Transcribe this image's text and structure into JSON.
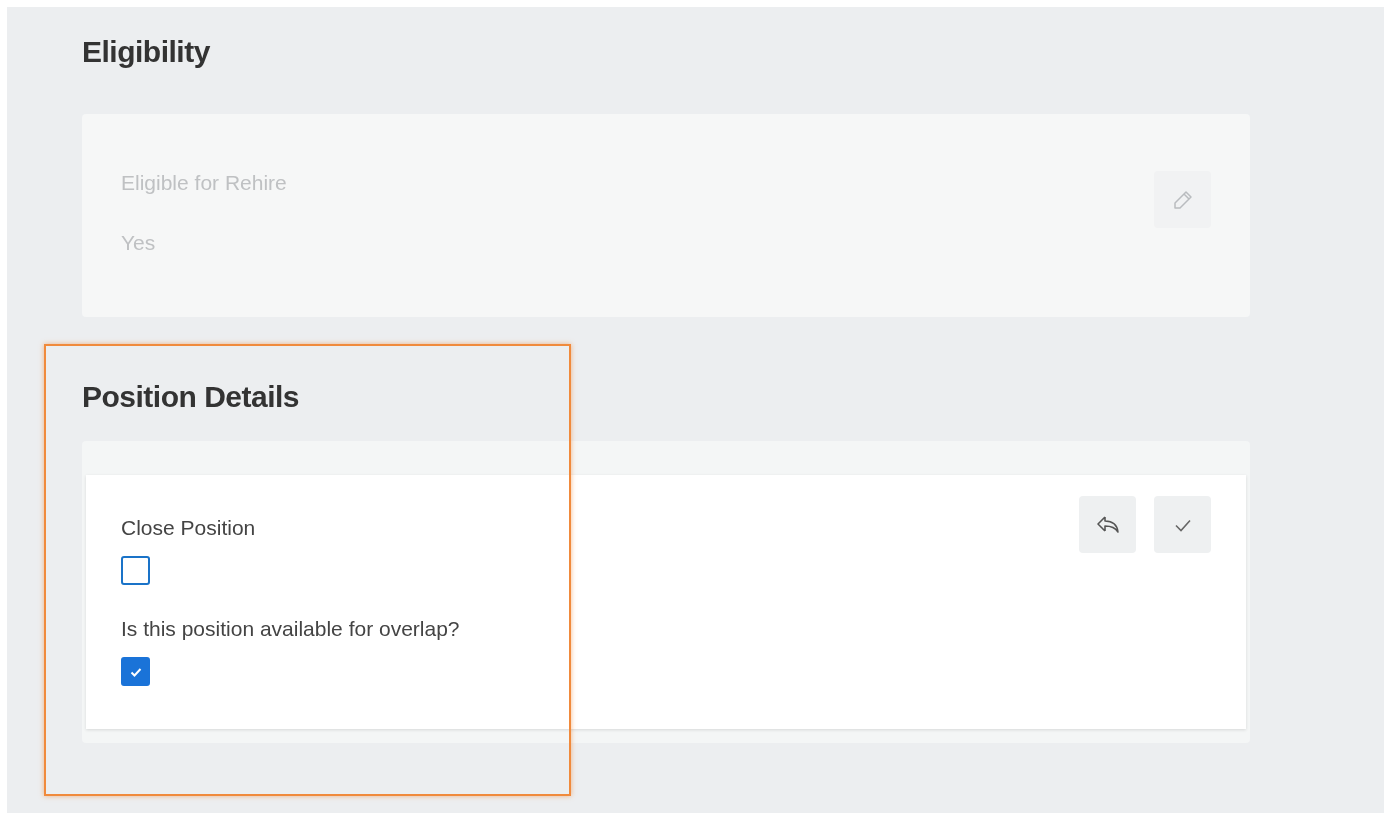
{
  "eligibility": {
    "title": "Eligibility",
    "fields": [
      {
        "label": "Eligible for Rehire",
        "value": "Yes"
      }
    ],
    "disabled": true
  },
  "position_details": {
    "title": "Position Details",
    "highlighted": true,
    "fields": [
      {
        "label": "Close Position",
        "checked": false
      },
      {
        "label": "Is this position available for overlap?",
        "checked": true
      }
    ]
  }
}
